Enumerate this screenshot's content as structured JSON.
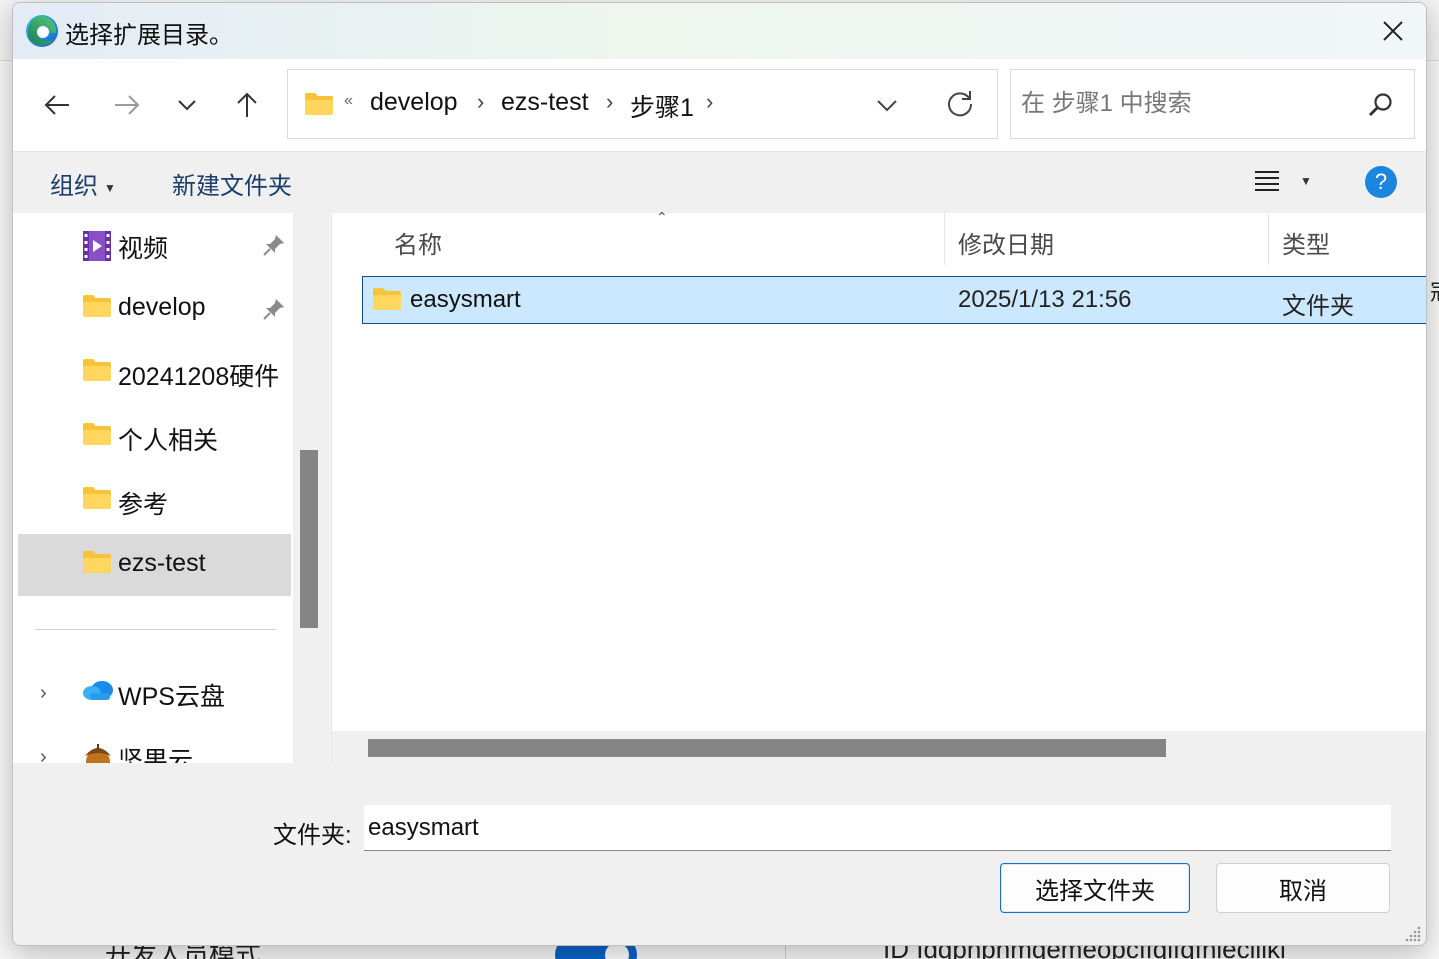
{
  "background": {
    "left_text": "开发人员模式",
    "right_text": "ID Idqphphmqemeopcffqifqfnieciiikl",
    "edge_char": "冠"
  },
  "dialog": {
    "title": "选择扩展目录。",
    "close_icon": "close-icon"
  },
  "nav": {
    "back_icon": "arrow-left-icon",
    "forward_icon": "arrow-right-icon",
    "recent_icon": "chevron-down-icon",
    "up_icon": "arrow-up-icon",
    "breadcrumb_overflow": "«",
    "breadcrumb": [
      "develop",
      "ezs-test",
      "步骤1"
    ],
    "breadcrumb_separator": "›",
    "search_placeholder": "在 步骤1 中搜索"
  },
  "toolbar": {
    "organize": "组织",
    "new_folder": "新建文件夹",
    "help": "?"
  },
  "sidebar": {
    "items": [
      {
        "label": "视频",
        "icon": "video-icon",
        "pinned": true
      },
      {
        "label": "develop",
        "icon": "folder-icon",
        "pinned": true
      },
      {
        "label": "20241208硬件",
        "icon": "folder-icon",
        "pinned": false
      },
      {
        "label": "个人相关",
        "icon": "folder-icon",
        "pinned": false
      },
      {
        "label": "参考",
        "icon": "folder-icon",
        "pinned": false
      },
      {
        "label": "ezs-test",
        "icon": "folder-icon",
        "pinned": false,
        "selected": true
      }
    ],
    "locations": [
      {
        "label": "WPS云盘",
        "icon": "cloud-icon"
      },
      {
        "label": "坚果云",
        "icon": "nut-icon"
      }
    ]
  },
  "columns": {
    "name": "名称",
    "modified": "修改日期",
    "type": "类型"
  },
  "files": [
    {
      "name": "easysmart",
      "modified": "2025/1/13 21:56",
      "type": "文件夹",
      "selected": true
    }
  ],
  "footer": {
    "folder_label": "文件夹:",
    "folder_value": "easysmart",
    "select_button": "选择文件夹",
    "cancel_button": "取消"
  },
  "colors": {
    "accent": "#1a86e0",
    "selection": "#cce8ff",
    "folder": "#f8c23a"
  }
}
